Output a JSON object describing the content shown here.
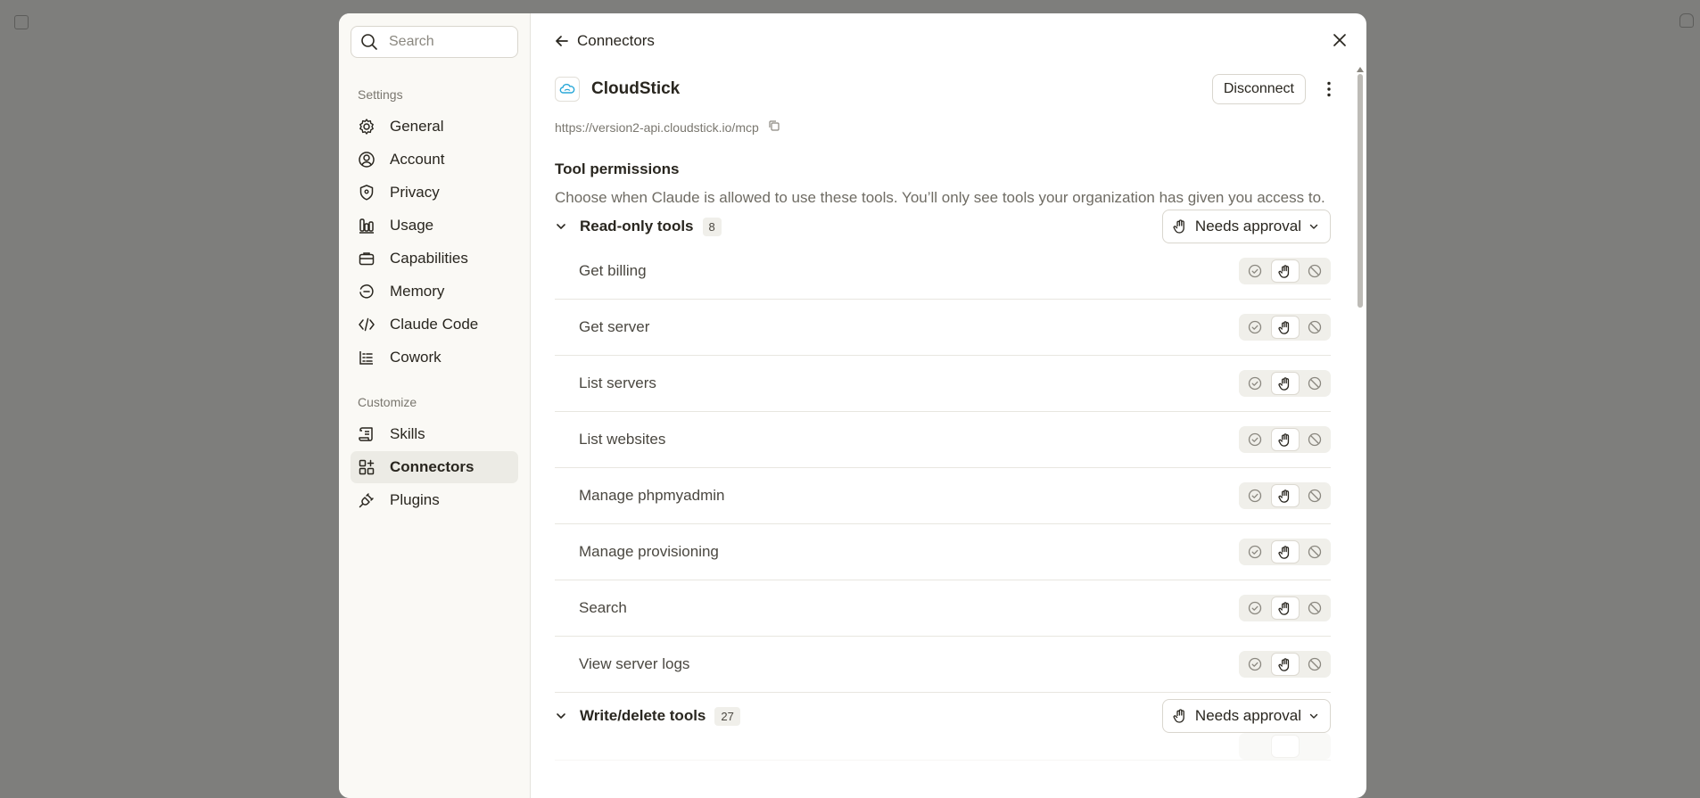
{
  "sidebar": {
    "search_placeholder": "Search",
    "settings_label": "Settings",
    "settings_items": [
      {
        "label": "General",
        "icon": "gear-icon"
      },
      {
        "label": "Account",
        "icon": "user-circle-icon"
      },
      {
        "label": "Privacy",
        "icon": "shield-icon"
      },
      {
        "label": "Usage",
        "icon": "bar-chart-icon"
      },
      {
        "label": "Capabilities",
        "icon": "briefcase-icon"
      },
      {
        "label": "Memory",
        "icon": "history-icon"
      },
      {
        "label": "Claude Code",
        "icon": "code-icon"
      },
      {
        "label": "Cowork",
        "icon": "checklist-icon"
      }
    ],
    "customize_label": "Customize",
    "customize_items": [
      {
        "label": "Skills",
        "icon": "scroll-icon"
      },
      {
        "label": "Connectors",
        "icon": "grid-plus-icon",
        "active": true
      },
      {
        "label": "Plugins",
        "icon": "plug-icon"
      }
    ]
  },
  "header": {
    "back_label": "Connectors"
  },
  "connector": {
    "name": "CloudStick",
    "url": "https://version2-api.cloudstick.io/mcp",
    "disconnect_label": "Disconnect"
  },
  "permissions": {
    "title": "Tool permissions",
    "description": "Choose when Claude is allowed to use these tools. You’ll only see tools your organization has given you access to."
  },
  "groups": [
    {
      "title": "Read-only tools",
      "count": "8",
      "approval_label": "Needs approval",
      "tools": [
        "Get billing",
        "Get server",
        "List servers",
        "List websites",
        "Manage phpmyadmin",
        "Manage provisioning",
        "Search",
        "View server logs"
      ]
    },
    {
      "title": "Write/delete tools",
      "count": "27",
      "approval_label": "Needs approval"
    }
  ],
  "colors": {
    "overlay": "#7e7e7c",
    "active_nav": "#ecebe5",
    "accent_logo": "#2aa8d8"
  }
}
